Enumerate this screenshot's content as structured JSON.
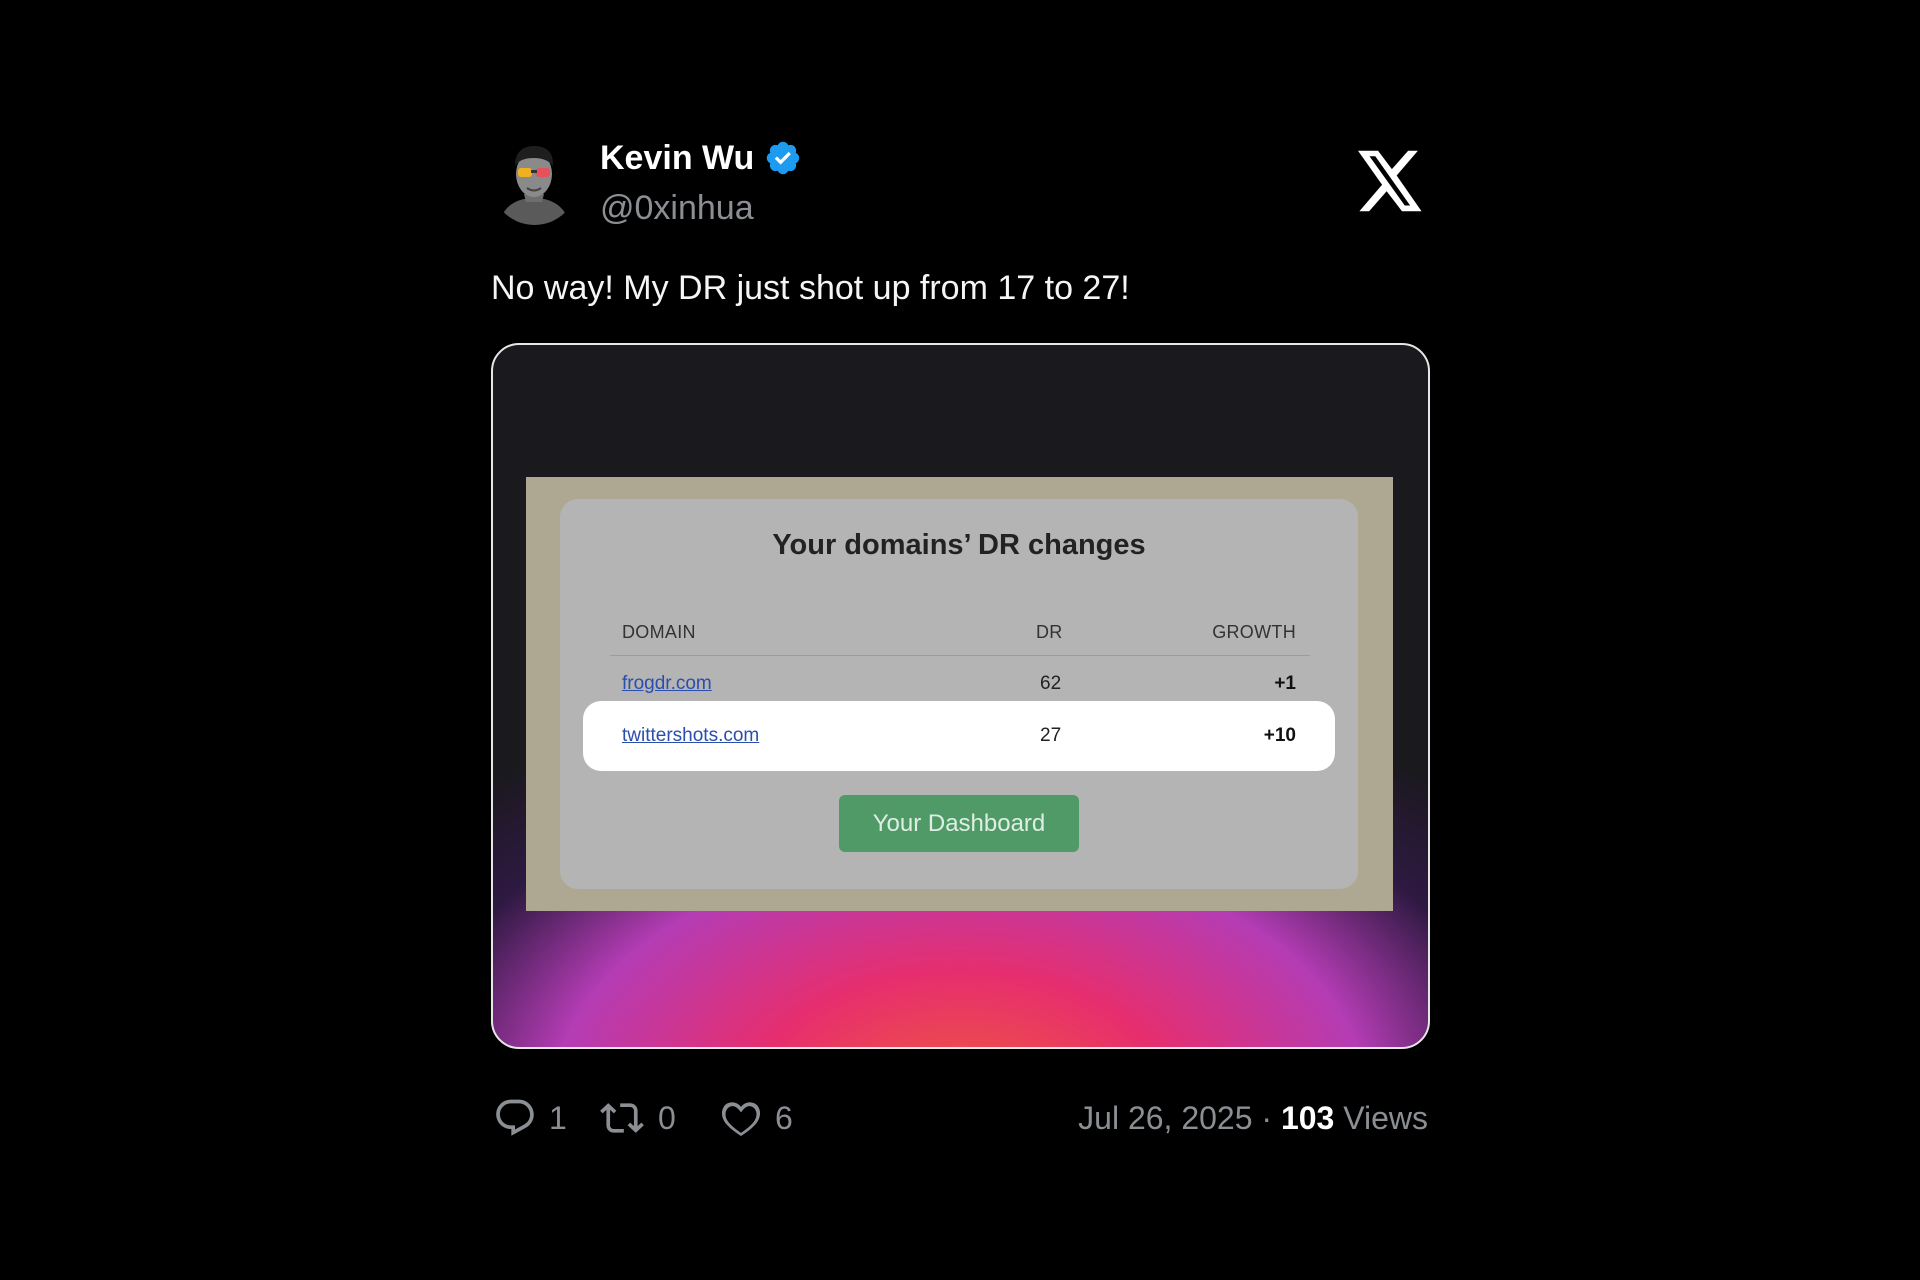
{
  "author": {
    "name": "Kevin Wu",
    "handle": "@0xinhua",
    "verified": true,
    "verified_color": "#1d9bf0"
  },
  "tweet_text": "No way! My DR just shot up from 17 to 27!",
  "media": {
    "title": "Your domains’ DR changes",
    "columns": [
      "DOMAIN",
      "DR",
      "GROWTH"
    ],
    "rows": [
      {
        "domain": "frogdr.com",
        "dr": "62",
        "growth": "+1"
      },
      {
        "domain": "twittershots.com",
        "dr": "27",
        "growth": "+10",
        "highlighted": true
      }
    ],
    "button_label": "Your Dashboard",
    "button_color": "#4f9a67"
  },
  "actions": {
    "replies": "1",
    "retweets": "0",
    "likes": "6"
  },
  "meta": {
    "date": "Jul 26, 2025",
    "separator": "·",
    "views_count": "103",
    "views_label": "Views"
  },
  "icons": [
    "verified-badge-icon",
    "x-logo-icon",
    "reply-icon",
    "retweet-icon",
    "like-icon"
  ]
}
